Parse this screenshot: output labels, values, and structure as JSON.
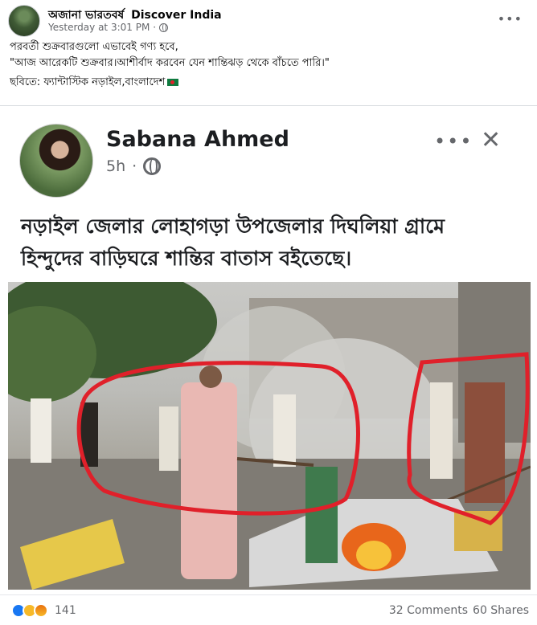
{
  "post": {
    "author": "অজানা ভারতবর্ষ",
    "group": "Discover India",
    "timestamp": "Yesterday at 3:01 PM",
    "more_icon": "more-horizontal-icon",
    "privacy_icon": "globe-icon",
    "caption_lines": [
      "পরবর্তী শুক্রবারগুলো এভাবেই গণ্য হবে,",
      "\"আজ আরেকটি শুক্রবার।আশীর্বাদ করবেন যেন শান্তিঝড় থেকে বাঁচতে পারি।\"",
      "ছবিতে: ফ্যান্টাস্টিক নড়াইল,বাংলাদেশ"
    ],
    "flag_icon": "bangladesh-flag-icon"
  },
  "embedded": {
    "name": "Sabana Ahmed",
    "time": "5h",
    "separator": "·",
    "dots_icon": "•••",
    "close_icon": "✕",
    "text_lines": [
      "নড়াইল জেলার লোহাগড়া উপজেলার দিঘলিয়া গ্রামে",
      "হিন্দুদের বাড়িঘরে শান্তির বাতাস বইতেছে।"
    ]
  },
  "footer": {
    "reaction_count": "141",
    "comments": "32 Comments",
    "shares": "60 Shares",
    "reaction_icons": [
      "like-icon",
      "sad-icon",
      "angry-icon"
    ]
  },
  "colors": {
    "link_blue": "#1877f2",
    "annotation_red": "#e0202a",
    "secondary_text": "#65676b"
  }
}
